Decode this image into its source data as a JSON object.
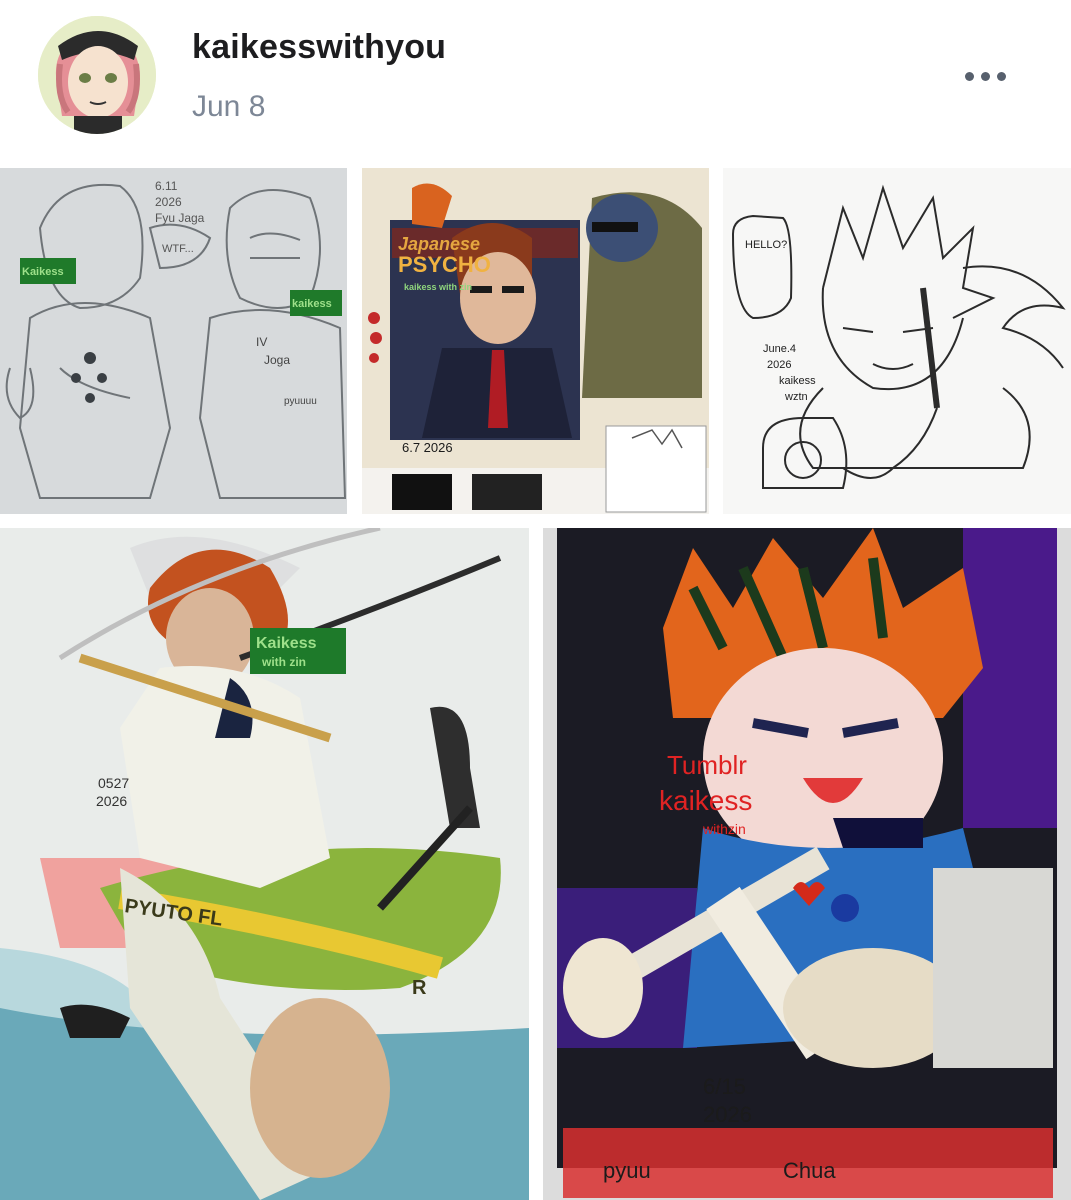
{
  "post": {
    "username": "kaikesswithyou",
    "date": "Jun 8",
    "more_icon": "more-horizontal-icon"
  },
  "artworks": [
    {
      "texts": [
        "6.11",
        "2026",
        "Fyu Jaga",
        "WTF...",
        "Kaikess",
        "kaikess",
        "IV",
        "Joga",
        "pyuuuu"
      ]
    },
    {
      "texts": [
        "Japanese",
        "PSYCHO",
        "kaikess with zin",
        "6.7 2026"
      ]
    },
    {
      "texts": [
        "HELLO?",
        "June.4",
        "2026",
        "kaikess",
        "wztn"
      ]
    },
    {
      "texts": [
        "Kaikess",
        "with zin",
        "0527",
        "2026",
        "PYUTO FL",
        "R"
      ]
    },
    {
      "texts": [
        "Tumblr",
        "kaikess",
        "withzin",
        "6/15",
        "2026",
        "pyuu",
        "Chua"
      ]
    }
  ]
}
